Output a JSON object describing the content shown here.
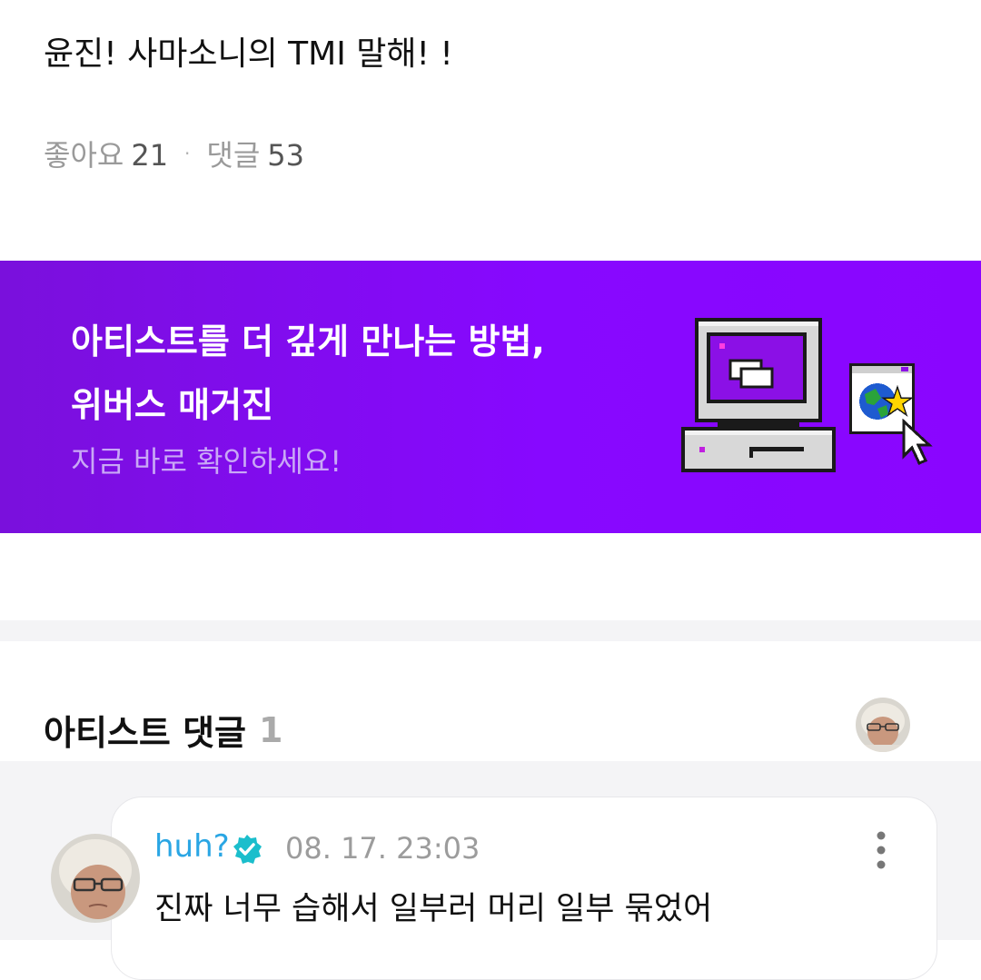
{
  "post": {
    "title": "윤진! 사마소니의 TMI 말해! !",
    "likes_label": "좋아요",
    "likes_count": "21",
    "separator": "·",
    "comments_label": "댓글",
    "comments_count": "53"
  },
  "banner": {
    "line1": "아티스트를 더 깊게 만나는 방법,",
    "line2": "위버스 매거진",
    "sub": "지금 바로 확인하세요!",
    "colors": {
      "start": "#7a10dc",
      "end": "#8a05ff"
    }
  },
  "artist_comments": {
    "title": "아티스트 댓글",
    "count": "1"
  },
  "comment": {
    "author": "huh?",
    "verified_icon": "verified-badge-icon",
    "date": "08. 17. 23:03",
    "text": "진짜 너무 습해서 일부러 머리 일부 묶었어",
    "name_color": "#2aa6e4"
  }
}
